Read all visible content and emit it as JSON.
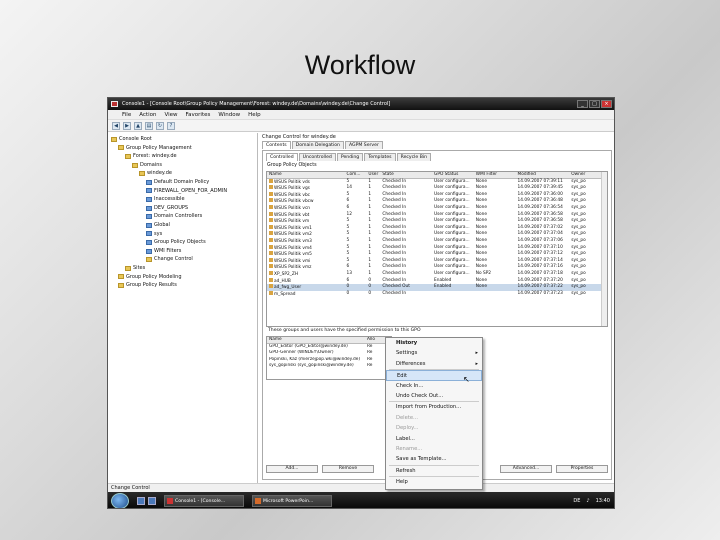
{
  "slide": {
    "title": "Workflow"
  },
  "window": {
    "title": "Console1 - [Console Root\\Group Policy Management\\Forest: windey.de\\Domains\\windey.de\\Change Control]",
    "menu": [
      "File",
      "Action",
      "View",
      "Favorites",
      "Window",
      "Help"
    ]
  },
  "tree": [
    {
      "label": "Console Root",
      "indent": 0
    },
    {
      "label": "Group Policy Management",
      "indent": 1
    },
    {
      "label": "Forest: windey.de",
      "indent": 2
    },
    {
      "label": "Domains",
      "indent": 3
    },
    {
      "label": "windey.de",
      "indent": 4
    },
    {
      "label": "Default Domain Policy",
      "indent": 5
    },
    {
      "label": "FIREWALL_OPEN_FOR_ADMIN",
      "indent": 5
    },
    {
      "label": "Inaccessible",
      "indent": 5
    },
    {
      "label": "DEV_GROUPS",
      "indent": 5
    },
    {
      "label": "Domain Controllers",
      "indent": 5
    },
    {
      "label": "Global",
      "indent": 5
    },
    {
      "label": "sys",
      "indent": 5
    },
    {
      "label": "Group Policy Objects",
      "indent": 5
    },
    {
      "label": "WMI Filters",
      "indent": 5
    },
    {
      "label": "Change Control",
      "indent": 5
    },
    {
      "label": "Sites",
      "indent": 2
    },
    {
      "label": "Group Policy Modeling",
      "indent": 1
    },
    {
      "label": "Group Policy Results",
      "indent": 1
    }
  ],
  "panel": {
    "header": "Change Control for windey.de",
    "tabs": [
      "Contents",
      "Domain Delegation",
      "AGPM Server"
    ],
    "subtabs": [
      "Controlled",
      "Uncontrolled",
      "Pending",
      "Templates",
      "Recycle Bin"
    ],
    "group_label": "Group Policy Objects",
    "columns": [
      "Name",
      "Com...",
      "User",
      "State",
      "GPO Status",
      "WMI Filter",
      "Modified",
      "Owner"
    ],
    "rows": [
      [
        "WSUS Politik vds",
        "5",
        "1",
        "Checked In",
        "User configura...",
        "None",
        "14.09.2007 07:39:11",
        "sys_po"
      ],
      [
        "WSUS Politik vgs",
        "14",
        "1",
        "Checked In",
        "User configura...",
        "None",
        "14.09.2007 07:39:45",
        "sys_po"
      ],
      [
        "WSUS Politik vbc",
        "5",
        "1",
        "Checked In",
        "User configura...",
        "None",
        "14.09.2007 07:36:00",
        "sys_po"
      ],
      [
        "WSUS Politik vbcw",
        "6",
        "1",
        "Checked In",
        "User configura...",
        "None",
        "14.09.2007 07:36:48",
        "sys_po"
      ],
      [
        "WSUS Politik vcn",
        "6",
        "1",
        "Checked In",
        "User configura...",
        "None",
        "14.09.2007 07:36:54",
        "sys_po"
      ],
      [
        "WSUS Politik vbt",
        "12",
        "1",
        "Checked In",
        "User configura...",
        "None",
        "14.09.2007 07:36:58",
        "sys_po"
      ],
      [
        "WSUS Politik vm",
        "5",
        "1",
        "Checked In",
        "User configura...",
        "None",
        "14.09.2007 07:36:58",
        "sys_po"
      ],
      [
        "WSUS Politik vm1",
        "5",
        "1",
        "Checked In",
        "User configura...",
        "None",
        "14.09.2007 07:37:02",
        "sys_po"
      ],
      [
        "WSUS Politik vm2",
        "5",
        "1",
        "Checked In",
        "User configura...",
        "None",
        "14.09.2007 07:37:04",
        "sys_po"
      ],
      [
        "WSUS Politik vm3",
        "5",
        "1",
        "Checked In",
        "User configura...",
        "None",
        "14.09.2007 07:37:06",
        "sys_po"
      ],
      [
        "WSUS Politik vm4",
        "5",
        "1",
        "Checked In",
        "User configura...",
        "None",
        "14.09.2007 07:37:10",
        "sys_po"
      ],
      [
        "WSUS Politik vm5",
        "5",
        "1",
        "Checked In",
        "User configura...",
        "None",
        "14.09.2007 07:37:12",
        "sys_po"
      ],
      [
        "WSUS Politik vmi",
        "5",
        "1",
        "Checked In",
        "User configura...",
        "None",
        "14.09.2007 07:37:14",
        "sys_po"
      ],
      [
        "WSUS Politik vmz",
        "6",
        "1",
        "Checked In",
        "User configura...",
        "None",
        "14.09.2007 07:37:16",
        "sys_po"
      ],
      [
        "XP_SP2_ZH",
        "13",
        "1",
        "Checked In",
        "User configura...",
        "No SP2",
        "14.09.2007 07:37:18",
        "sys_po"
      ],
      [
        "ad_HUB",
        "6",
        "0",
        "Checked In",
        "Enabled",
        "None",
        "14.09.2007 07:37:20",
        "sys_po"
      ],
      [
        "ad_fwg_User",
        "0",
        "0",
        "Checked Out",
        "Enabled",
        "None",
        "14.09.2007 07:37:22",
        "sys_po"
      ],
      [
        "m_Spread",
        "0",
        "0",
        "Checked In",
        "",
        "",
        "14.09.2007 07:37:23",
        "sys_po"
      ]
    ],
    "lower_label": "These groups and users have the specified permission to this GPO",
    "lower_columns": [
      "Name",
      "Allo"
    ],
    "lower_rows": [
      [
        "GPO_Editor (GPO_Editor@windey.de)",
        "Re"
      ],
      [
        "GPO-Genner (WINDEY\\Owner)",
        "Re"
      ],
      [
        "Popinski, Kaz (mierzejpop.wki@windey.de)",
        "Re"
      ],
      [
        "sys_gopinski (sys_gopinski@windey.de)",
        "Re"
      ]
    ],
    "buttons_left": [
      "Add...",
      "Remove"
    ],
    "buttons_right": [
      "Advanced...",
      "Properties"
    ]
  },
  "context_menu": [
    {
      "label": "History",
      "disabled": false,
      "sub": false,
      "bold": true
    },
    {
      "label": "Settings",
      "disabled": false,
      "sub": true
    },
    {
      "label": "Differences",
      "disabled": false,
      "sub": true
    },
    {
      "sep": true
    },
    {
      "label": "Edit",
      "disabled": false,
      "sub": false,
      "highlight": true
    },
    {
      "label": "Check In...",
      "disabled": false,
      "sub": false
    },
    {
      "label": "Undo Check Out...",
      "disabled": false,
      "sub": false
    },
    {
      "sep": true
    },
    {
      "label": "Import from Production...",
      "disabled": false,
      "sub": false
    },
    {
      "label": "Delete...",
      "disabled": true,
      "sub": false
    },
    {
      "label": "Deploy...",
      "disabled": true,
      "sub": false
    },
    {
      "label": "Label...",
      "disabled": false,
      "sub": false
    },
    {
      "label": "Rename...",
      "disabled": true,
      "sub": false
    },
    {
      "label": "Save as Template...",
      "disabled": false,
      "sub": false
    },
    {
      "sep": true
    },
    {
      "label": "Refresh",
      "disabled": false,
      "sub": false
    },
    {
      "sep": true
    },
    {
      "label": "Help",
      "disabled": false,
      "sub": false
    }
  ],
  "status": "Change Control",
  "taskbar": {
    "tasks": [
      "Console1 - [Console...",
      "Microsoft PowerPoin..."
    ],
    "lang": "DE",
    "clock": "13:40"
  }
}
